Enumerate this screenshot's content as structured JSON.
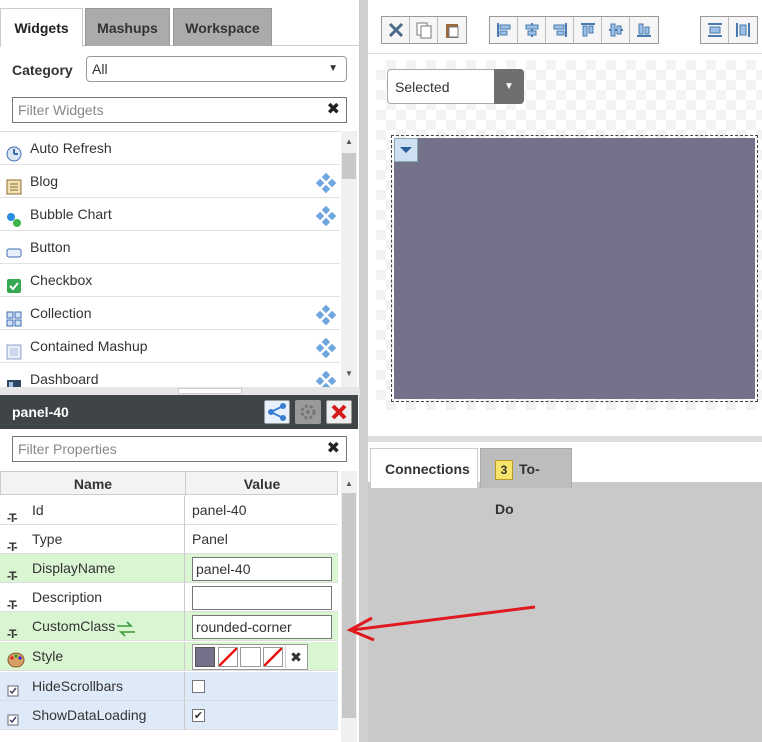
{
  "left_tabs": [
    "Widgets",
    "Mashups",
    "Workspace"
  ],
  "category": {
    "label": "Category",
    "value": "All"
  },
  "widget_filter": {
    "placeholder": "Filter Widgets"
  },
  "widgets": [
    {
      "label": "Auto Refresh",
      "icon": "clock-icon",
      "mashup": false
    },
    {
      "label": "Blog",
      "icon": "blog-icon",
      "mashup": true
    },
    {
      "label": "Bubble Chart",
      "icon": "bubble-chart-icon",
      "mashup": true
    },
    {
      "label": "Button",
      "icon": "button-icon",
      "mashup": false
    },
    {
      "label": "Checkbox",
      "icon": "checkbox-icon",
      "mashup": false
    },
    {
      "label": "Collection",
      "icon": "collection-icon",
      "mashup": true
    },
    {
      "label": "Contained Mashup",
      "icon": "contained-mashup-icon",
      "mashup": true
    },
    {
      "label": "Dashboard",
      "icon": "dashboard-icon",
      "mashup": true
    }
  ],
  "properties_panel": {
    "title": "panel-40"
  },
  "property_filter": {
    "placeholder": "Filter Properties"
  },
  "prop_headers": {
    "name": "Name",
    "value": "Value"
  },
  "properties": [
    {
      "name": "Id",
      "value": "panel-40",
      "kind": "text"
    },
    {
      "name": "Type",
      "value": "Panel",
      "kind": "text"
    },
    {
      "name": "DisplayName",
      "value": "panel-40",
      "kind": "input"
    },
    {
      "name": "Description",
      "value": "",
      "kind": "input"
    },
    {
      "name": "CustomClass",
      "value": "rounded-corner",
      "kind": "input"
    },
    {
      "name": "Style",
      "value": "",
      "kind": "style"
    },
    {
      "name": "HideScrollbars",
      "checked": false,
      "kind": "checkbox"
    },
    {
      "name": "ShowDataLoading",
      "checked": true,
      "kind": "checkbox"
    }
  ],
  "canvas": {
    "selected_label": "Selected",
    "panel_color": "#74728a"
  },
  "bottom_tabs": {
    "connections": "Connections",
    "todo_count": "3",
    "todo": "To-Do"
  },
  "colors": {
    "accent_green": "#d9f5d2",
    "accent_blue": "#dfeaf8",
    "annotation_red": "#e0191f"
  }
}
